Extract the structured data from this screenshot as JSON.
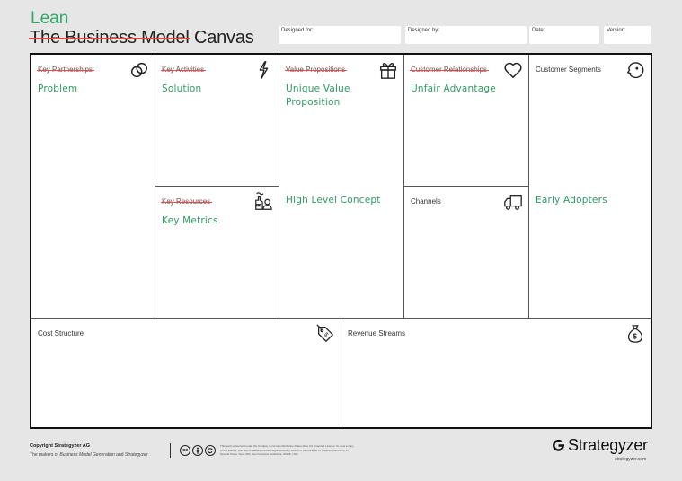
{
  "header": {
    "lean_title": "Lean",
    "struck_title": "The Business Model",
    "canvas_word": "Canvas"
  },
  "meta": {
    "designed_for": "Designed for:",
    "designed_by": "Designed by:",
    "date": "Date:",
    "version": "Version:"
  },
  "colors": {
    "lean_green": "#2eaa6b",
    "note_green": "#2e9c63",
    "strike_red": "#e04a4a",
    "background": "#e6e6e6"
  },
  "blocks": {
    "key_partnerships": {
      "label": "Key Partnerships",
      "struck": true,
      "note": "Problem",
      "icon": "link-icon"
    },
    "key_activities": {
      "label": "Key Activities",
      "struck": true,
      "note": "Solution",
      "icon": "lightning-icon"
    },
    "key_resources": {
      "label": "Key Resources",
      "struck": true,
      "note": "Key Metrics",
      "icon": "factory-person-icon"
    },
    "value_propositions": {
      "label": "Value Propositions",
      "struck": true,
      "note": "Unique Value Proposition",
      "note2": "High Level Concept",
      "icon": "gift-icon"
    },
    "customer_relationships": {
      "label": "Customer Relationships",
      "struck": true,
      "note": "Unfair Advantage",
      "icon": "heart-icon"
    },
    "channels": {
      "label": "Channels",
      "struck": false,
      "icon": "truck-icon"
    },
    "customer_segments": {
      "label": "Customer Segments",
      "struck": false,
      "note": "Early Adopters",
      "icon": "face-icon"
    },
    "cost_structure": {
      "label": "Cost Structure",
      "struck": false,
      "icon": "price-tag-icon"
    },
    "revenue_streams": {
      "label": "Revenue Streams",
      "struck": false,
      "icon": "money-bag-icon"
    }
  },
  "footer": {
    "copyright": "Copyright Strategyzer AG",
    "tagline_prefix": "The makers of ",
    "tagline_italic1": "Business Model Generation",
    "tagline_mid": " and ",
    "tagline_italic2": "Strategyzer",
    "cc_icons": [
      "cc",
      "by",
      "sa"
    ],
    "license_text": "This work is licensed under the Creative Commons Attribution-Share Alike 3.0 Unported License. To view a copy of this license, visit http://creativecommons.org/licenses/by-sa/3.0/ or send a letter to Creative Commons, 171 Second Street, Suite 300, San Francisco, California, 94105, USA.",
    "brand": "Strategyzer",
    "brand_url": "strategyzer.com"
  }
}
